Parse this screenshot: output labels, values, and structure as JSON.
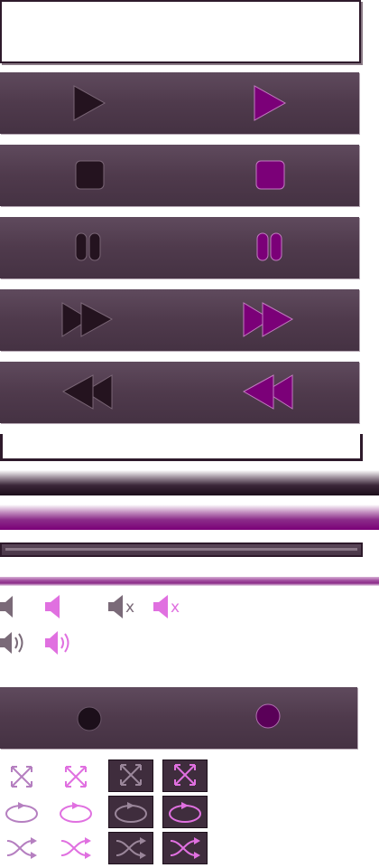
{
  "controls": {
    "play": "play",
    "stop": "stop",
    "pause": "pause",
    "fast_forward": "fast-forward",
    "rewind": "rewind",
    "record": "record"
  },
  "volume": {
    "mute_label": "x"
  },
  "colors": {
    "bar_top": "#5f4a5d",
    "bar_bottom": "#453243",
    "icon_dark": "#24131f",
    "icon_magenta": "#7b0078",
    "icon_pink": "#e070e0",
    "icon_lilac": "#b57fc0",
    "icon_grey": "#7a6a78"
  },
  "icons": [
    "play-icon",
    "stop-icon",
    "pause-icon",
    "fast-forward-icon",
    "rewind-icon",
    "volume-icon",
    "mute-icon",
    "speaker-icon",
    "record-icon",
    "fullscreen-icon",
    "repeat-icon",
    "shuffle-icon"
  ]
}
